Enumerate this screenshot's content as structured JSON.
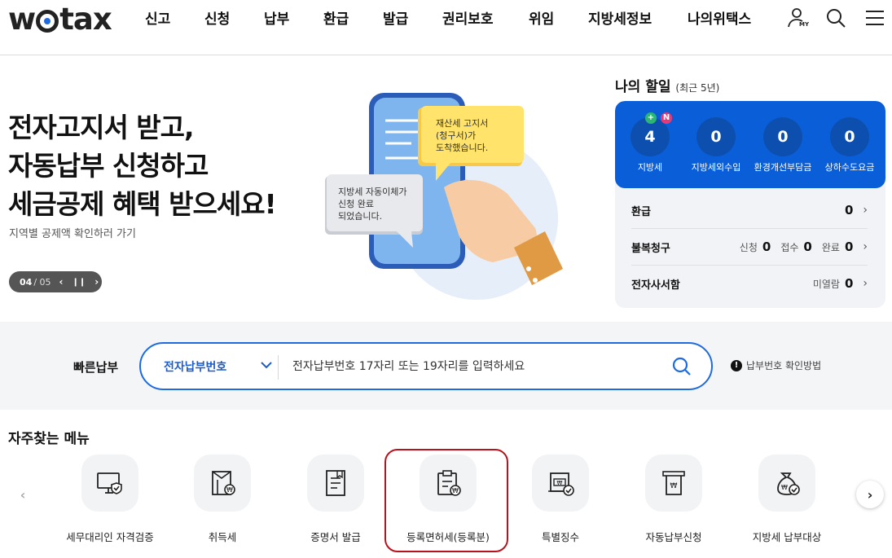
{
  "header": {
    "logo": "wetax",
    "nav": [
      "신고",
      "신청",
      "납부",
      "환급",
      "발급",
      "권리보호",
      "위임",
      "지방세정보",
      "나의위택스"
    ],
    "my_badge": "MY"
  },
  "hero": {
    "title_lines": [
      "전자고지서 받고,",
      "자동납부 신청하고",
      "세금공제 혜택 받으세요!"
    ],
    "subtitle": "지역별 공제액 확인하러 가기",
    "pager_current": "04",
    "pager_total": "/ 05",
    "bubble_yellow": [
      "재산세 고지서",
      "(청구서)가",
      "도착했습니다."
    ],
    "bubble_gray": [
      "지방세 자동이체가",
      "신청 완료",
      "되었습니다."
    ]
  },
  "todo": {
    "title": "나의 할일",
    "period": "(최근 5년)",
    "counters": [
      {
        "label": "지방세",
        "value": "4"
      },
      {
        "label": "지방세외수입",
        "value": "0"
      },
      {
        "label": "환경개선부담금",
        "value": "0"
      },
      {
        "label": "상하수도요금",
        "value": "0"
      }
    ],
    "badges": {
      "plus": "+",
      "new": "N"
    },
    "rows": {
      "refund": {
        "label": "환급",
        "value": "0"
      },
      "appeal": {
        "label": "불복청구",
        "items": [
          {
            "label": "신청",
            "value": "0"
          },
          {
            "label": "접수",
            "value": "0"
          },
          {
            "label": "완료",
            "value": "0"
          }
        ]
      },
      "mailbox": {
        "label": "전자사서함",
        "sub_label": "미열람",
        "value": "0"
      }
    }
  },
  "quickpay": {
    "label": "빠른납부",
    "select_value": "전자납부번호",
    "placeholder": "전자납부번호 17자리 또는 19자리를 입력하세요",
    "help": "납부번호 확인방법"
  },
  "frequent": {
    "title": "자주찾는 메뉴",
    "items": [
      {
        "label": "세무대리인 자격검증",
        "icon": "monitor-shield-icon"
      },
      {
        "label": "취득세",
        "icon": "building-won-icon"
      },
      {
        "label": "증명서 발급",
        "icon": "document-icon"
      },
      {
        "label": "등록면허세(등록분)",
        "icon": "clipboard-won-icon"
      },
      {
        "label": "특별징수",
        "icon": "box-check-icon"
      },
      {
        "label": "자동납부신청",
        "icon": "receipt-icon"
      },
      {
        "label": "지방세 납부대상",
        "icon": "money-bag-check-icon"
      }
    ]
  },
  "colors": {
    "accent": "#0a5ed8",
    "highlight": "#b5141f",
    "badge_green": "#2bb673",
    "badge_pink": "#e6397a"
  }
}
